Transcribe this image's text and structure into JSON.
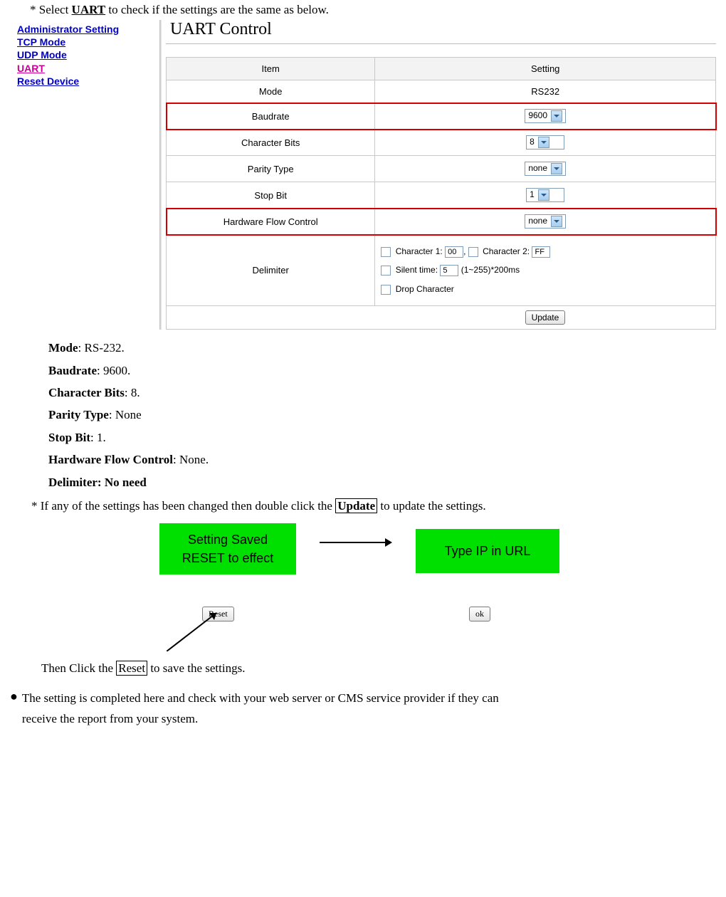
{
  "intro": {
    "select_prefix": "* Select ",
    "uart_word": "UART",
    "select_suffix": " to check if the settings are the same as below."
  },
  "sidebar": {
    "items": [
      {
        "label": "Administrator Setting"
      },
      {
        "label": "TCP Mode"
      },
      {
        "label": "UDP Mode"
      },
      {
        "label": "UART"
      },
      {
        "label": "Reset Device"
      }
    ]
  },
  "panel": {
    "title": "UART Control",
    "header": {
      "item": "Item",
      "setting": "Setting"
    },
    "rows": {
      "mode": {
        "label": "Mode",
        "value": "RS232"
      },
      "baudrate": {
        "label": "Baudrate",
        "value": "9600"
      },
      "charbits": {
        "label": "Character Bits",
        "value": "8"
      },
      "parity": {
        "label": "Parity Type",
        "value": "none"
      },
      "stopbit": {
        "label": "Stop Bit",
        "value": "1"
      },
      "hwflow": {
        "label": "Hardware Flow Control",
        "value": "none"
      },
      "delimiter": {
        "label": "Delimiter",
        "char1_label": "Character 1:",
        "char1_val": "00",
        "char2_label": "Character 2:",
        "char2_val": "FF",
        "silent_label": "Silent time:",
        "silent_val": "5",
        "silent_suffix": "(1~255)*200ms",
        "drop_label": "Drop Character"
      }
    },
    "update_btn": "Update"
  },
  "specs": {
    "mode": "RS-232.",
    "baudrate": "9600.",
    "charbits": "8.",
    "parity": "None",
    "stopbit": "1.",
    "hwflow": "None.",
    "delimiter": "No need"
  },
  "spec_labels": {
    "mode": "Mode",
    "baudrate": "Baudrate",
    "charbits": "Character Bits",
    "parity": "Parity Type",
    "stopbit": "Stop Bit",
    "hwflow": "Hardware Flow Control",
    "delimiter": "Delimiter:"
  },
  "update_note": {
    "prefix": "* If any of the settings has been changed then double click the ",
    "boxed": "Update",
    "suffix": " to update the settings."
  },
  "green": {
    "box1_line1": "Setting Saved",
    "box1_line2": "RESET to effect",
    "box2": "Type IP in URL",
    "reset_btn": "Reset",
    "ok_btn": "ok"
  },
  "then_line": {
    "prefix": "Then Click the ",
    "boxed": "Reset",
    "suffix": " to save the settings."
  },
  "closing": {
    "line1": "The setting is completed here and check with your web server or CMS service provider if they can",
    "line2": "receive the report from your system."
  }
}
